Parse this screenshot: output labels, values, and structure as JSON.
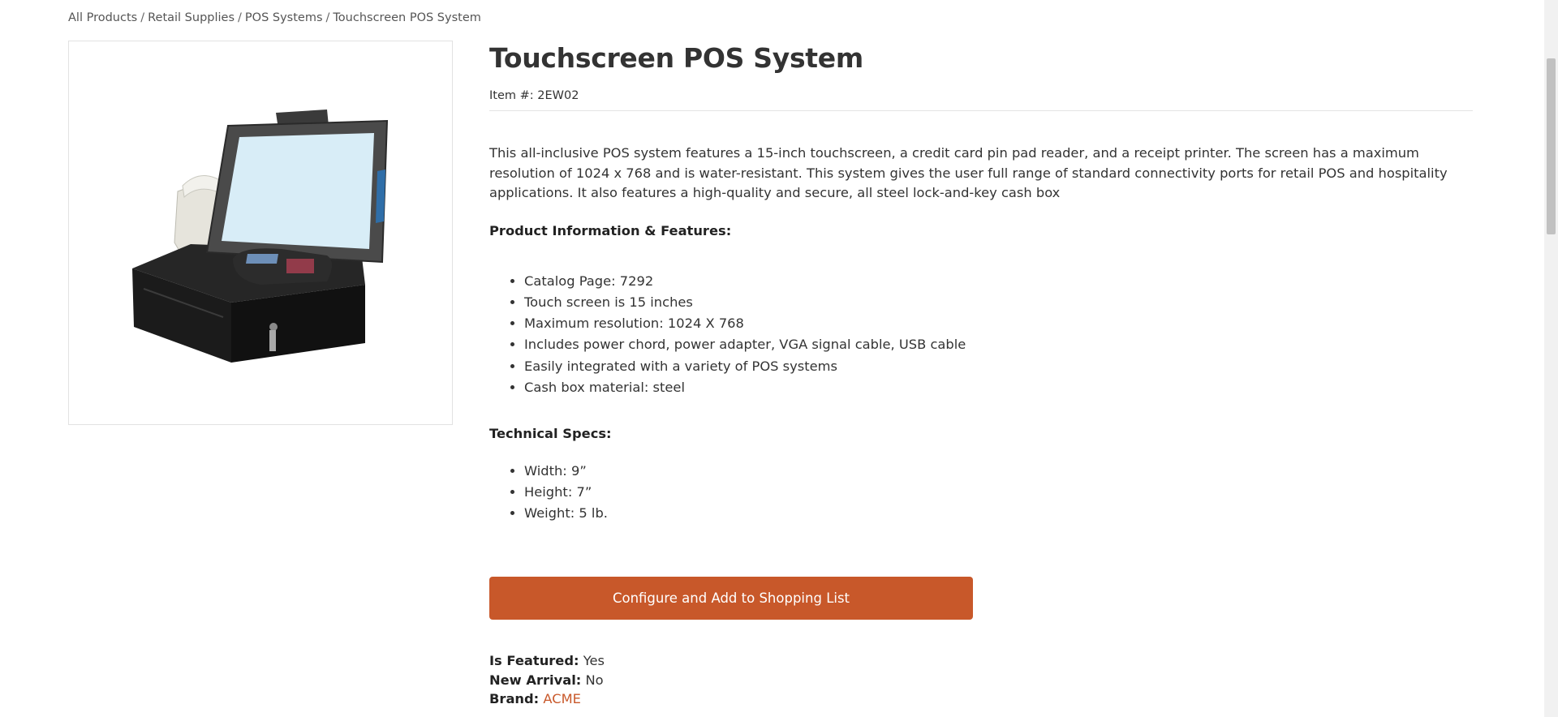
{
  "breadcrumb": {
    "items": [
      "All Products",
      "Retail Supplies",
      "POS Systems",
      "Touchscreen POS System"
    ],
    "separator": "/"
  },
  "product": {
    "title": "Touchscreen POS System",
    "item_number": "Item #: 2EW02",
    "description": "This all-inclusive POS system features a 15-inch touchscreen, a credit card pin pad reader, and a receipt printer. The screen has a maximum resolution of 1024 x 768 and is water-resistant. This system gives the user full range of standard connectivity ports for retail POS and hospitality applications. It also features a high-quality and secure, all steel lock-and-key cash box",
    "features_heading": "Product Information & Features:",
    "features": [
      "Catalog Page: 7292",
      "Touch screen is 15 inches",
      "Maximum resolution: 1024 X 768",
      "Includes power chord, power adapter, VGA signal cable, USB cable",
      "Easily integrated with a variety of POS systems",
      "Cash box material: steel"
    ],
    "specs_heading": "Technical Specs:",
    "specs": [
      "Width: 9”",
      "Height: 7”",
      "Weight: 5 lb."
    ],
    "cta_label": "Configure and Add to Shopping List",
    "meta": {
      "is_featured_label": "Is Featured:",
      "is_featured_value": "Yes",
      "new_arrival_label": "New Arrival:",
      "new_arrival_value": "No",
      "brand_label": "Brand:",
      "brand_value": "ACME"
    }
  },
  "colors": {
    "accent": "#c8582a",
    "text": "#333333",
    "border": "#e2e2e2"
  }
}
